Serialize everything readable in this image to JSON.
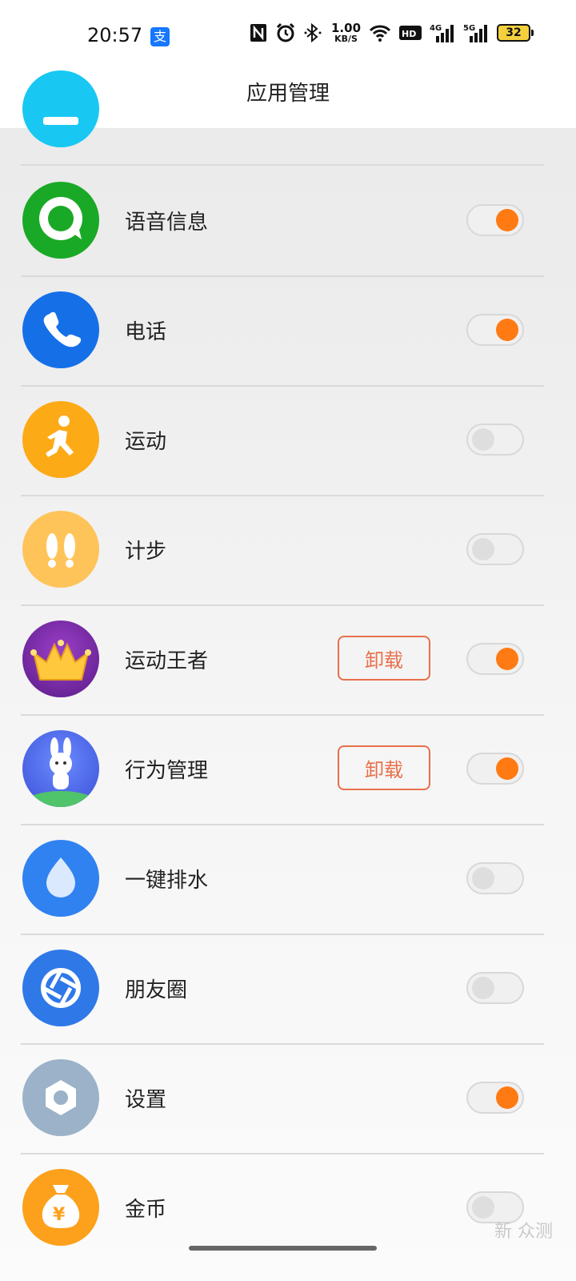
{
  "status_bar": {
    "time": "20:57",
    "alipay_glyph": "支",
    "speed_value": "1.00",
    "speed_unit": "KB/S",
    "battery": "32",
    "icons": [
      "nfc-icon",
      "alarm-icon",
      "bluetooth-icon",
      "wifi-icon",
      "hd-icon",
      "signal-4g-icon",
      "signal-5g-icon",
      "battery-icon"
    ]
  },
  "header": {
    "title": "应用管理"
  },
  "apps": [
    {
      "label": "",
      "icon": "partial-cyan-app-icon",
      "enabled": null,
      "uninstall": false
    },
    {
      "label": "语音信息",
      "icon": "voice-message-icon",
      "enabled": true,
      "uninstall": false
    },
    {
      "label": "电话",
      "icon": "phone-icon",
      "enabled": true,
      "uninstall": false
    },
    {
      "label": "运动",
      "icon": "running-icon",
      "enabled": false,
      "uninstall": false
    },
    {
      "label": "计步",
      "icon": "footsteps-icon",
      "enabled": false,
      "uninstall": false
    },
    {
      "label": "运动王者",
      "icon": "sports-king-icon",
      "enabled": true,
      "uninstall": true,
      "uninstall_label": "卸载"
    },
    {
      "label": "行为管理",
      "icon": "behavior-manage-icon",
      "enabled": true,
      "uninstall": true,
      "uninstall_label": "卸载"
    },
    {
      "label": "一键排水",
      "icon": "water-drop-icon",
      "enabled": false,
      "uninstall": false
    },
    {
      "label": "朋友圈",
      "icon": "camera-shutter-icon",
      "enabled": false,
      "uninstall": false
    },
    {
      "label": "设置",
      "icon": "settings-hex-icon",
      "enabled": true,
      "uninstall": false
    },
    {
      "label": "金币",
      "icon": "coin-bag-icon",
      "enabled": false,
      "uninstall": false
    }
  ],
  "colors": {
    "accent": "#ff7a13",
    "uninstall": "#e8704a"
  },
  "watermark": "新 众测"
}
